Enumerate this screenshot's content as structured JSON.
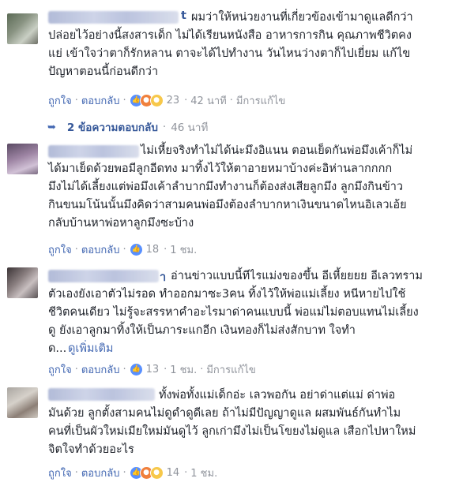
{
  "comments": [
    {
      "name_visible_tail": "t",
      "text": "ผมว่าให้หน่วยงานที่เกี่ยวข้องเข้ามาดูแลดีกว่า\nปล่อยไว้อย่างนี้สงสารเด็ก ไม่ได้เรียนหนังสือ อาหารการกิน คุณภาพชีวิตคง\nแย่ เข้าใจว่าตาก็รักหลาน ตาจะได้ไปทำงาน วันไหนว่างตาก็ไปเยี่ยม แก้ไข\nปัญหาตอนนี้ก่อนดีกว่า",
      "like": "ถูกใจ",
      "reply": "ตอบกลับ",
      "reactions": [
        "like",
        "angry",
        "sad"
      ],
      "count": "23",
      "time": "42 นาที",
      "edited": "มีการแก้ไข"
    },
    {
      "text": "ไม่เหี้ยจริงทำไม่ได้น่ะมึงอิแนน ตอนเย็ดกันพ่อมึงเค้าก็ไม่\nได้มาเย็ดด้วยพอมีลูกอีดทง มาทิ้งไว้ให้ตาอายหมาบ้างค่ะอิห่านลากกกก\nมึงไม่ได้เลี้ยงแต่พ่อมึงเค้าลำบากมึงทำงานก็ต้องส่งเสียลูกมึง ลูกมึงกินข้าว\nกินขนมโน้นนั้นมึงคิดว่าสามคนพ่อมึงต้องลำบากหาเงินขนาดไหนอิเลวเอ้ย\nกลับบ้านหาพ่อหาลูกมึงซะบ้าง",
      "like": "ถูกใจ",
      "reply": "ตอบกลับ",
      "reactions": [
        "like"
      ],
      "count": "18",
      "time": "1 ชม."
    },
    {
      "name_visible_tail": "า",
      "text": "อ่านข่าวแบบนี้ทีไรแม่งของขึ้น อีเหี้ยยยย อีเลวทราม\nตัวเองยังเอาตัวไม่รอด ทำออกมาซะ3คน ทิ้งไว้ให้พ่อแม่เลี้ยง หนีหายไปใช้\nชีวิตคนเดียว ไม่รู้จะสรรหาคำอะไรมาด่าคนแบบนี้ พ่อแม่ไม่ตอบแทนไม่เลี้ยง\nดู ยังเอาลูกมาทิ้งให้เป็นภาระแกอีก เงินทองก็ไม่ส่งสักบาท ใจทำ\nด...",
      "see_more": "ดูเพิ่มเติม",
      "like": "ถูกใจ",
      "reply": "ตอบกลับ",
      "reactions": [
        "like"
      ],
      "count": "13",
      "time": "1 ชม.",
      "edited": "มีการแก้ไข"
    },
    {
      "text": "ทั้งพ่อทั้งแม่เด็กอ่ะ เลวพอกัน อย่าด่าแต่แม่ ด่าพ่อ\nมันด้วย ลูกตั้งสามคนไม่ดูดำดูดีเลย ถ้าไม่มีปัญญาดูแล ผสมพันธ์กันทำไม\nคนที่เป็นผัวใหม่เมียใหม่มันดูไว้ ลูกเก่ามึงไม่เป็นโขยงไม่ดูแล เสือกไปหาใหม่\nจิตใจทำด้วยอะไร",
      "like": "ถูกใจ",
      "reply": "ตอบกลับ",
      "reactions": [
        "like",
        "angry",
        "sad"
      ],
      "count": "14",
      "time": "1 ชม."
    }
  ],
  "replies_summary": {
    "label": "2 ข้อความตอบกลับ",
    "sep": "·",
    "time": "46 นาที"
  },
  "colors": {
    "link": "#4267b2",
    "meta": "#90949c",
    "text": "#1d2129"
  }
}
